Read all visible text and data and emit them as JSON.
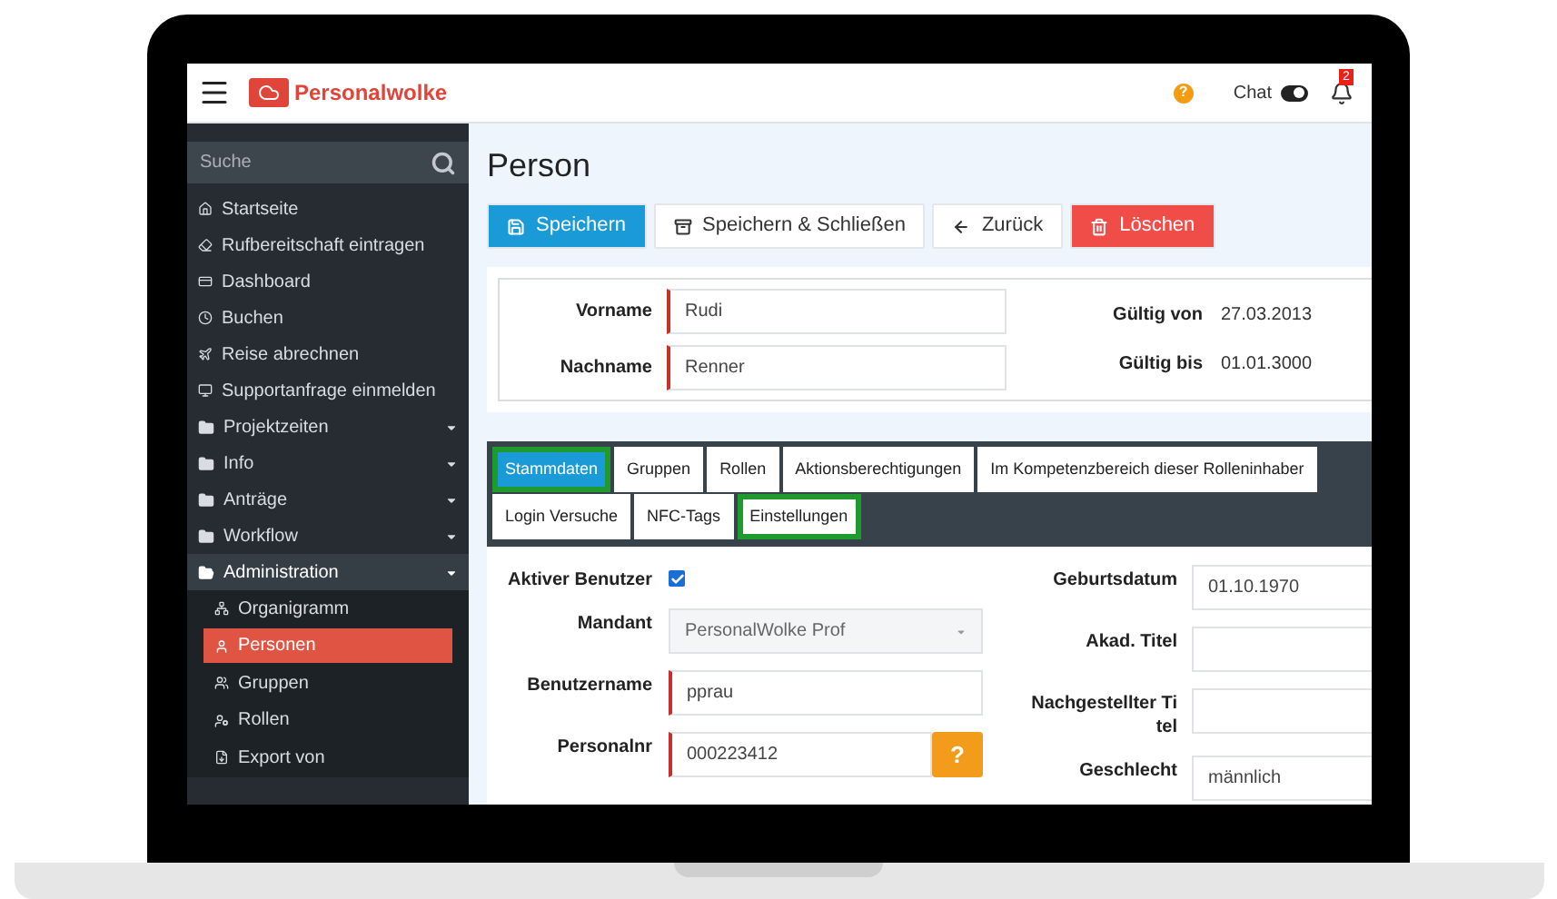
{
  "header": {
    "brand": "Personalwolke",
    "help_glyph": "?",
    "chat_label": "Chat",
    "chat_on": true,
    "notification_count": "2"
  },
  "sidebar": {
    "search_placeholder": "Suche",
    "items": [
      {
        "kind": "link",
        "label": "Startseite",
        "selected": false
      },
      {
        "kind": "link",
        "label": "Rufbereitschaft eintragen",
        "selected": false
      },
      {
        "kind": "link",
        "label": "Dashboard",
        "selected": false
      },
      {
        "kind": "link",
        "label": "Buchen",
        "selected": false
      },
      {
        "kind": "link",
        "label": "Reise abrechnen",
        "selected": false
      },
      {
        "kind": "link",
        "label": "Supportanfrage einmelden",
        "selected": false
      },
      {
        "kind": "group",
        "label": "Projektzeiten",
        "expanded": false
      },
      {
        "kind": "group",
        "label": "Info",
        "expanded": false
      },
      {
        "kind": "group",
        "label": "Anträge",
        "expanded": false
      },
      {
        "kind": "group",
        "label": "Workflow",
        "expanded": false
      },
      {
        "kind": "group",
        "label": "Administration",
        "expanded": true,
        "children": [
          {
            "label": "Organigramm",
            "selected": false
          },
          {
            "label": "Personen",
            "selected": true
          },
          {
            "label": "Gruppen",
            "selected": false
          },
          {
            "label": "Rollen",
            "selected": false
          },
          {
            "label": "Export von",
            "selected": false
          }
        ]
      }
    ]
  },
  "page": {
    "title": "Person",
    "buttons": [
      {
        "kind": "primary",
        "label": "Speichern"
      },
      {
        "kind": "default",
        "label": "Speichern & Schließen"
      },
      {
        "kind": "back",
        "label": "Zurück"
      },
      {
        "kind": "danger",
        "label": "Löschen"
      }
    ],
    "summary": {
      "fields": [
        {
          "label": "Vorname",
          "value": "Rudi",
          "required": true
        },
        {
          "label": "Nachname",
          "value": "Renner",
          "required": true
        }
      ],
      "validity": [
        {
          "label": "Gültig von",
          "value": "27.03.2013"
        },
        {
          "label": "Gültig bis",
          "value": "01.01.3000"
        }
      ]
    },
    "tab_rows": [
      [
        {
          "label": "Stammdaten",
          "selected": true,
          "highlighted": true
        },
        {
          "label": "Gruppen",
          "selected": false,
          "highlighted": false
        },
        {
          "label": "Rollen",
          "selected": false,
          "highlighted": false
        },
        {
          "label": "Aktionsberechtigungen",
          "selected": false,
          "highlighted": false
        },
        {
          "label": "Im Kompetenzbereich dieser Rolleninhaber",
          "selected": false,
          "highlighted": false
        }
      ],
      [
        {
          "label": "Login Versuche",
          "selected": false,
          "highlighted": false
        },
        {
          "label": "NFC-Tags",
          "selected": false,
          "highlighted": false
        },
        {
          "label": "Einstellungen",
          "selected": false,
          "highlighted": true
        }
      ]
    ],
    "form_left": [
      {
        "kind": "checkbox",
        "label": "Aktiver Benutzer",
        "checked": true
      },
      {
        "kind": "select",
        "label": "Mandant",
        "value": "PersonalWolke Prof",
        "disabled": true
      },
      {
        "kind": "text",
        "label": "Benutzername",
        "value": "pprau",
        "required": true
      },
      {
        "kind": "help",
        "label": "Personalnr",
        "value": "000223412",
        "required": true,
        "help": "?"
      }
    ],
    "form_right": [
      {
        "label": "Geburtsdatum",
        "value": "01.10.1970"
      },
      {
        "label": "Akad. Titel"
      },
      {
        "label": "Nachgestellter Titel"
      },
      {
        "label": "Geschlecht",
        "value": "männlich"
      }
    ]
  }
}
